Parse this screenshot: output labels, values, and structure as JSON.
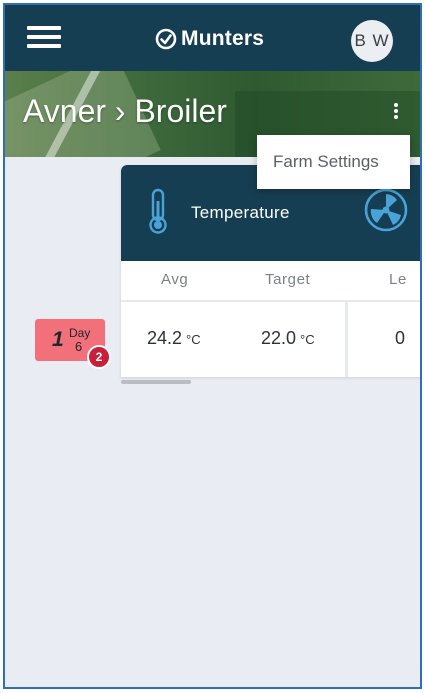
{
  "header": {
    "brand": "Munters",
    "avatar_initials": "B W",
    "icons": [
      "hamburger-menu-icon",
      "munters-logo-icon"
    ]
  },
  "hero": {
    "breadcrumb": "Avner › Broiler"
  },
  "menu": {
    "items": [
      {
        "label": "Farm Settings"
      }
    ]
  },
  "room": {
    "number": "1",
    "day_label": "Day",
    "day_value": "6",
    "alerts": "2",
    "status_color": "#f2707a",
    "alert_color": "#c81f3a"
  },
  "card": {
    "sensor": "Temperature",
    "icons": [
      "thermometer-icon",
      "fan-icon"
    ],
    "columns": [
      "Avg",
      "Target",
      "Le"
    ],
    "values": {
      "avg": "24.2",
      "avg_unit": "°C",
      "target": "22.0",
      "target_unit": "°C",
      "le": "0"
    }
  },
  "colors": {
    "header_bg": "#163e52",
    "page_bg": "#e9edf3",
    "accent_icon": "#4aa3d8"
  }
}
